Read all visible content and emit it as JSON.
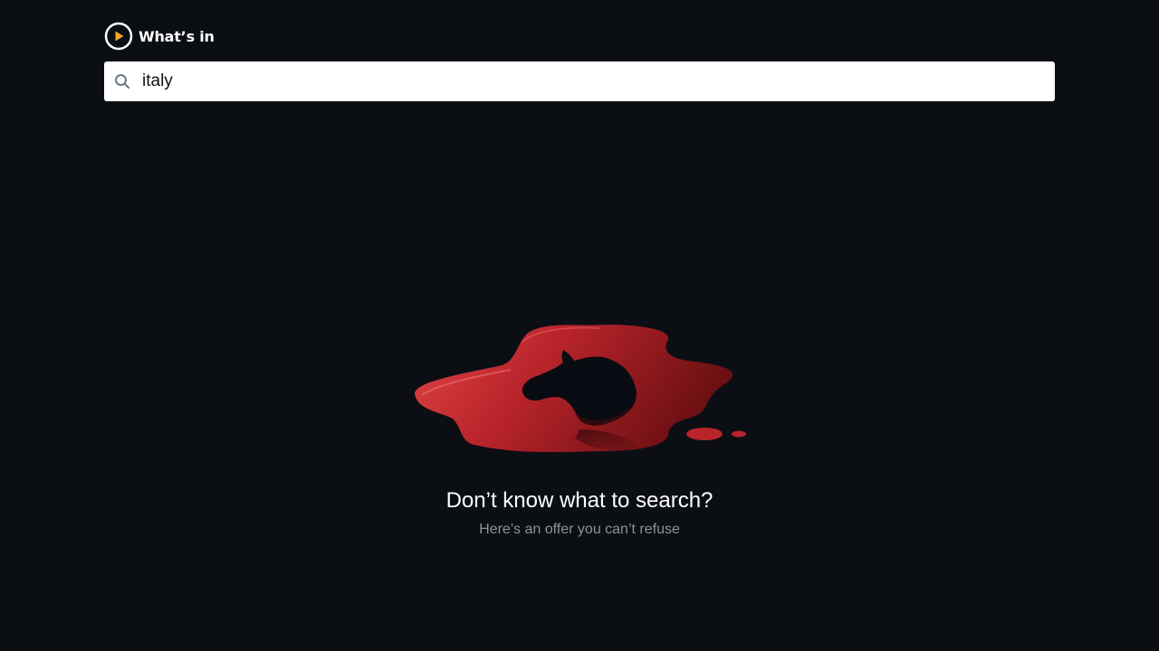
{
  "header": {
    "logo_text": "What’s in",
    "logo_icon": "play-circle-icon",
    "logo_accent_color": "#f5a623"
  },
  "search": {
    "value": "italy",
    "icon": "search-icon"
  },
  "empty_state": {
    "illustration": "horse-head-in-blood-pool",
    "title": "Don’t know what to search?",
    "subtitle": "Here’s an offer you can’t refuse"
  },
  "colors": {
    "background": "#0b0f13",
    "blood_red": "#c62a2f",
    "subtitle_gray": "#8a939c"
  }
}
